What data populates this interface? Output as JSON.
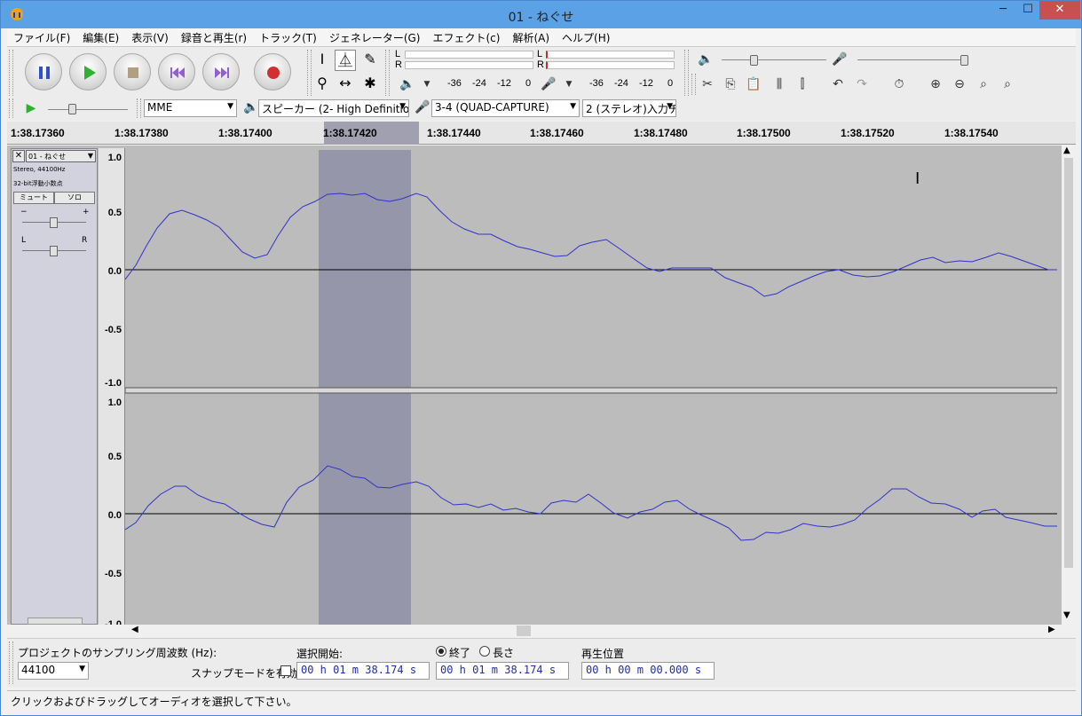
{
  "window": {
    "title": "01 - ねぐせ",
    "min": "─",
    "max": "☐",
    "close": "✕"
  },
  "menu": [
    "ファイル(F)",
    "編集(E)",
    "表示(V)",
    "録音と再生(r)",
    "トラック(T)",
    "ジェネレーター(G)",
    "エフェクト(c)",
    "解析(A)",
    "ヘルプ(H)"
  ],
  "meter": {
    "play_l": "L",
    "play_r": "R",
    "rec_l": "L",
    "rec_r": "R",
    "ticks": [
      "-36",
      "-24",
      "-12",
      "0"
    ]
  },
  "device": {
    "host": "MME",
    "output": "スピーカー (2- High Definitio",
    "input": "3-4 (QUAD-CAPTURE)",
    "channels": "2 (ステレオ)入力チ"
  },
  "ruler": [
    "1:38.17360",
    "1:38.17380",
    "1:38.17400",
    "1:38.17420",
    "1:38.17440",
    "1:38.17460",
    "1:38.17480",
    "1:38.17500",
    "1:38.17520",
    "1:38.17540"
  ],
  "track": {
    "name": "01 - ねぐせ",
    "info1": "Stereo, 44100Hz",
    "info2": "32-bit浮動小数点",
    "mute": "ミュート",
    "solo": "ソロ",
    "gain_minus": "−",
    "gain_plus": "+",
    "pan_l": "L",
    "pan_r": "R"
  },
  "scale": {
    "top": [
      "1.0",
      "0.5",
      "0.0",
      "-0.5",
      "-1.0"
    ],
    "bottom": [
      "1.0",
      "0.5",
      "0.0",
      "-0.5",
      "-1.0"
    ]
  },
  "selection": {
    "rate_label": "プロジェクトのサンプリング周波数 (Hz):",
    "rate": "44100",
    "snap_label": "スナップモードを有効",
    "start_label": "選択開始:",
    "end_label": "終了",
    "len_label": "長さ",
    "start": "00 h 01 m 38.174 s",
    "end": "00 h 01 m 38.174 s",
    "pos_label": "再生位置",
    "pos": "00 h 00 m 00.000 s"
  },
  "status": "クリックおよびドラッグしてオーディオを選択して下さい。",
  "colors": {
    "wave": "#3232c8",
    "selection": "#9696aa",
    "bg": "#bcbcbc"
  }
}
